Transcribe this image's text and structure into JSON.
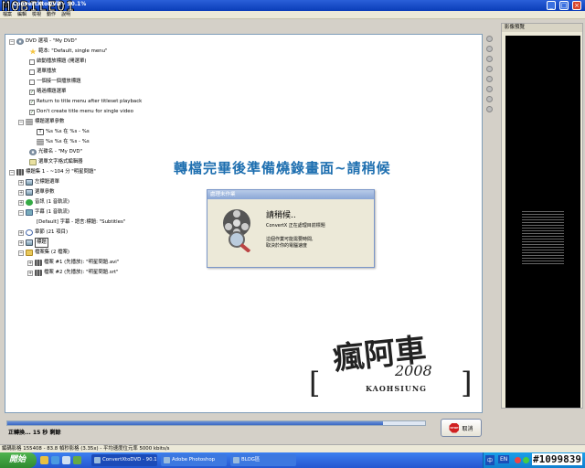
{
  "window": {
    "title": "ConvertXtoDVD - 90.1%",
    "logo_text": "MOBILE01"
  },
  "menu": [
    "檔案",
    "編輯",
    "檢視",
    "動作",
    "說明"
  ],
  "tree": {
    "root": "DVD 選項 - \"My DVD\"",
    "root_items": [
      {
        "label": "範本: \"Default, single menu\"",
        "kind": "star"
      },
      {
        "label": "啟動播放標題 (開選單)",
        "kind": "check",
        "checked": false
      },
      {
        "label": "選單播放",
        "kind": "check",
        "checked": false
      },
      {
        "label": "一個接一個播放標題",
        "kind": "check",
        "checked": false
      },
      {
        "label": "略過標題選單",
        "kind": "check",
        "checked": true
      },
      {
        "label": "Return to title menu after titleset playback",
        "kind": "check",
        "checked": true
      },
      {
        "label": "Don't create title menu for single video",
        "kind": "check",
        "checked": true
      }
    ],
    "title_params": "標題選單參數",
    "title_param_items": [
      "%s %s 在 %s - %s",
      "%s %s 在 %s - %s"
    ],
    "disc_label": "光碟名 - \"My DVD\"",
    "subtitle_editor": "選單文字格式編輯器",
    "title_set": "標題集 1 - ~104 分 \"明星問題\"",
    "title_set_items": [
      {
        "label": "左標題選單",
        "kind": "menu"
      },
      {
        "label": "選單參數",
        "kind": "menu"
      },
      {
        "label": "音訊 (1 音軌流)",
        "kind": "note"
      },
      {
        "label": "字幕 (1 音軌流)",
        "kind": "chat"
      }
    ],
    "subtitle_item": "[Default] 字幕 - 語言:標題: \"Subtitles\"",
    "title_set_items2": [
      {
        "label": "章節 (21 項目)",
        "kind": "clock"
      },
      {
        "label": "標題",
        "kind": "menu",
        "boxed": true
      },
      {
        "label": "檔案集 (2 檔案)",
        "kind": "folder"
      }
    ],
    "files": [
      "檔案 #1 (先播放): \"明星問題.avi\"",
      "檔案 #2 (先播放): \"明星問題.srt\""
    ]
  },
  "overlay_banner": "轉檔完畢後準備燒錄畫面~請稍候",
  "dialog": {
    "title": "處理未作業",
    "heading": "請稍候..",
    "line1": "ConvertX 正在處理目前標題",
    "line2": "這個作業可能需要時間,",
    "line3": "取決於你的電腦速度"
  },
  "watermark": {
    "chinese": "瘋阿車",
    "year": "2008",
    "city": "KAOHSIUNG"
  },
  "progress": {
    "fraction": 0.9,
    "time_left": "正轉換... 15 秒 剩餘"
  },
  "cancel_label": "取消",
  "stop_icon_text": "STOP",
  "preview": {
    "title": "影像預覽"
  },
  "status_bar": "編碼影格 155408 - 83.8 幀秒影格 (3.35x) - 平均速度位元率 5000 kbits/s",
  "taskbar": {
    "start_label": "開始",
    "tasks": [
      "ConvertXtoDVD - 90.1%",
      "Adobe Photoshop",
      "BLOG區"
    ],
    "ime": "中",
    "lang": "EN",
    "clock": "#1099839"
  }
}
